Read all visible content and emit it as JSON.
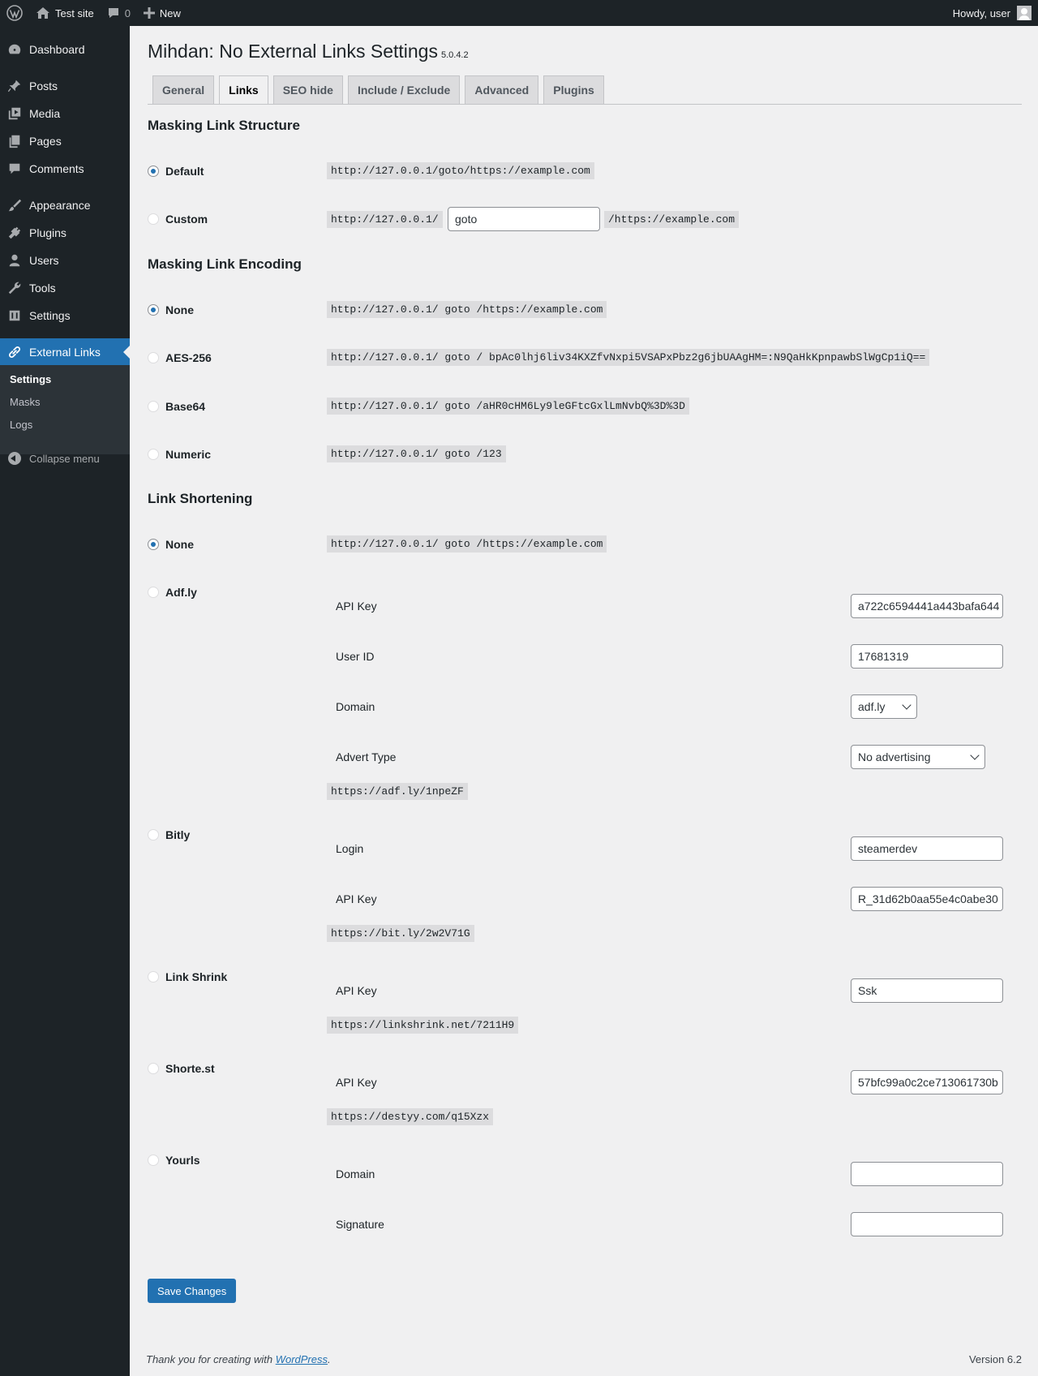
{
  "adminbar": {
    "site_name": "Test site",
    "comments_count": "0",
    "new_label": "New",
    "howdy": "Howdy, user"
  },
  "sidebar": {
    "items": [
      {
        "label": "Dashboard",
        "icon": "dashboard-icon"
      },
      {
        "label": "Posts",
        "icon": "pin-icon"
      },
      {
        "label": "Media",
        "icon": "media-icon"
      },
      {
        "label": "Pages",
        "icon": "pages-icon"
      },
      {
        "label": "Comments",
        "icon": "comment-icon"
      },
      {
        "label": "Appearance",
        "icon": "paintbrush-icon"
      },
      {
        "label": "Plugins",
        "icon": "plug-icon"
      },
      {
        "label": "Users",
        "icon": "users-icon"
      },
      {
        "label": "Tools",
        "icon": "wrench-icon"
      },
      {
        "label": "Settings",
        "icon": "sliders-icon"
      },
      {
        "label": "External Links",
        "icon": "link-icon"
      }
    ],
    "submenu": [
      "Settings",
      "Masks",
      "Logs"
    ],
    "collapse_label": "Collapse menu"
  },
  "page": {
    "title": "Mihdan: No External Links Settings",
    "version": "5.0.4.2",
    "tabs": [
      "General",
      "Links",
      "SEO hide",
      "Include / Exclude",
      "Advanced",
      "Plugins"
    ],
    "active_tab": "Links"
  },
  "structure": {
    "heading": "Masking Link Structure",
    "default_label": "Default",
    "default_code": "http://127.0.0.1/goto/https://example.com",
    "custom_label": "Custom",
    "custom_prefix": "http://127.0.0.1/",
    "custom_value": "goto",
    "custom_suffix": "/https://example.com",
    "selected": "Default"
  },
  "encoding": {
    "heading": "Masking Link Encoding",
    "options": [
      {
        "label": "None",
        "code": "http://127.0.0.1/ goto /https://example.com"
      },
      {
        "label": "AES-256",
        "code": "http://127.0.0.1/ goto / bpAc0lhj6liv34KXZfvNxpi5VSAPxPbz2g6jbUAAgHM=:N9QaHkKpnpawbSlWgCp1iQ=="
      },
      {
        "label": "Base64",
        "code": "http://127.0.0.1/ goto /aHR0cHM6Ly9leGFtcGxlLmNvbQ%3D%3D"
      },
      {
        "label": "Numeric",
        "code": "http://127.0.0.1/ goto /123"
      }
    ],
    "selected": "None"
  },
  "shortening": {
    "heading": "Link Shortening",
    "none_label": "None",
    "none_code": "http://127.0.0.1/ goto /https://example.com",
    "selected": "None",
    "adfly": {
      "label": "Adf.ly",
      "api_key_label": "API Key",
      "api_key": "a722c6594441a443bafa644",
      "user_id_label": "User ID",
      "user_id": "17681319",
      "domain_label": "Domain",
      "domain": "adf.ly",
      "advert_label": "Advert Type",
      "advert": "No advertising",
      "example": "https://adf.ly/1npeZF"
    },
    "bitly": {
      "label": "Bitly",
      "login_label": "Login",
      "login": "steamerdev",
      "api_key_label": "API Key",
      "api_key": "R_31d62b0aa55e4c0abe30",
      "example": "https://bit.ly/2w2V71G"
    },
    "linkshrink": {
      "label": "Link Shrink",
      "api_key_label": "API Key",
      "api_key": "Ssk",
      "example": "https://linkshrink.net/7211H9"
    },
    "shortest": {
      "label": "Shorte.st",
      "api_key_label": "API Key",
      "api_key": "57bfc99a0c2ce713061730b",
      "example": "https://destyy.com/q15Xzx"
    },
    "yourls": {
      "label": "Yourls",
      "domain_label": "Domain",
      "domain": "",
      "signature_label": "Signature",
      "signature": ""
    }
  },
  "save_label": "Save Changes",
  "footer": {
    "thanks_prefix": "Thank you for creating with ",
    "wp_link": "WordPress",
    "thanks_suffix": ".",
    "version": "Version 6.2"
  }
}
